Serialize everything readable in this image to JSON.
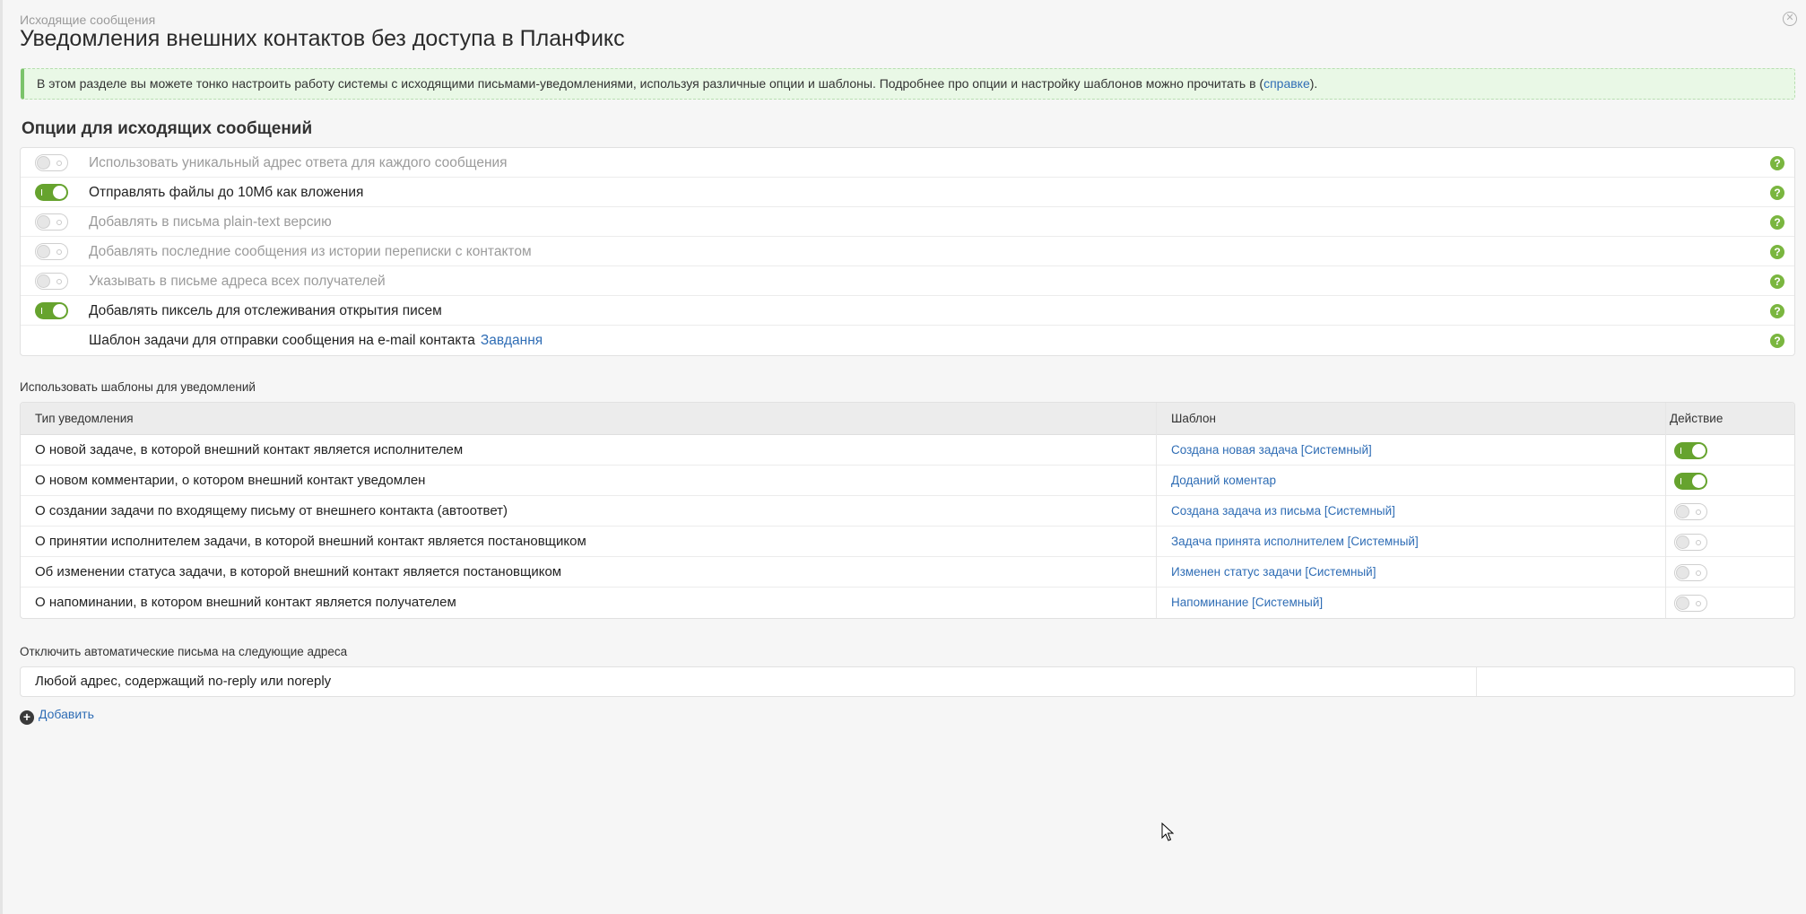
{
  "header": {
    "subtitle": "Исходящие сообщения",
    "title": "Уведомления внешних контактов без доступа в ПланФикс"
  },
  "info": {
    "text_before": "В этом разделе вы можете тонко настроить работу системы с исходящими письмами-уведомлениями, используя различные опции и шаблоны. Подробнее про опции и настройку шаблонов можно прочитать в (",
    "link": "справке",
    "text_after": ")."
  },
  "options_section": {
    "heading": "Опции для исходящих сообщений",
    "items": [
      {
        "label": "Использовать уникальный адрес ответа для каждого сообщения",
        "enabled": false
      },
      {
        "label": "Отправлять файлы до 10Мб как вложения",
        "enabled": true
      },
      {
        "label": "Добавлять в письма plain-text версию",
        "enabled": false
      },
      {
        "label": "Добавлять последние сообщения из истории переписки с контактом",
        "enabled": false
      },
      {
        "label": "Указывать в письме адреса всех получателей",
        "enabled": false
      },
      {
        "label": "Добавлять пиксель для отслеживания открытия писем",
        "enabled": true
      }
    ],
    "template_row": {
      "label": "Шаблон задачи для отправки сообщения на e-mail контакта",
      "link": "Завдання"
    },
    "help_glyph": "?"
  },
  "templates_section": {
    "heading": "Использовать шаблоны для уведомлений",
    "columns": {
      "type": "Тип уведомления",
      "template": "Шаблон",
      "action": "Действие"
    },
    "rows": [
      {
        "type": "О новой задаче, в которой внешний контакт является исполнителем",
        "template": "Создана новая задача [Системный]",
        "enabled": true
      },
      {
        "type": "О новом комментарии, о котором внешний контакт уведомлен",
        "template": "Доданий коментар",
        "enabled": true
      },
      {
        "type": "О создании задачи по входящему письму от внешнего контакта (автоответ)",
        "template": "Создана задача из письма [Системный]",
        "enabled": false
      },
      {
        "type": "О принятии исполнителем задачи, в которой внешний контакт является постановщиком",
        "template": "Задача принята исполнителем [Системный]",
        "enabled": false
      },
      {
        "type": "Об изменении статуса задачи, в которой внешний контакт является постановщиком",
        "template": "Изменен статус задачи [Системный]",
        "enabled": false
      },
      {
        "type": "О напоминании, в котором внешний контакт является получателем",
        "template": "Напоминание [Системный]",
        "enabled": false
      }
    ]
  },
  "autoreply_section": {
    "heading": "Отключить автоматические письма на следующие адреса",
    "address": "Любой адрес, содержащий no-reply или noreply",
    "add_label": "Добавить"
  },
  "colors": {
    "accent": "#66a32e",
    "link": "#2f6db5",
    "info_bg": "#e9f8e6"
  }
}
